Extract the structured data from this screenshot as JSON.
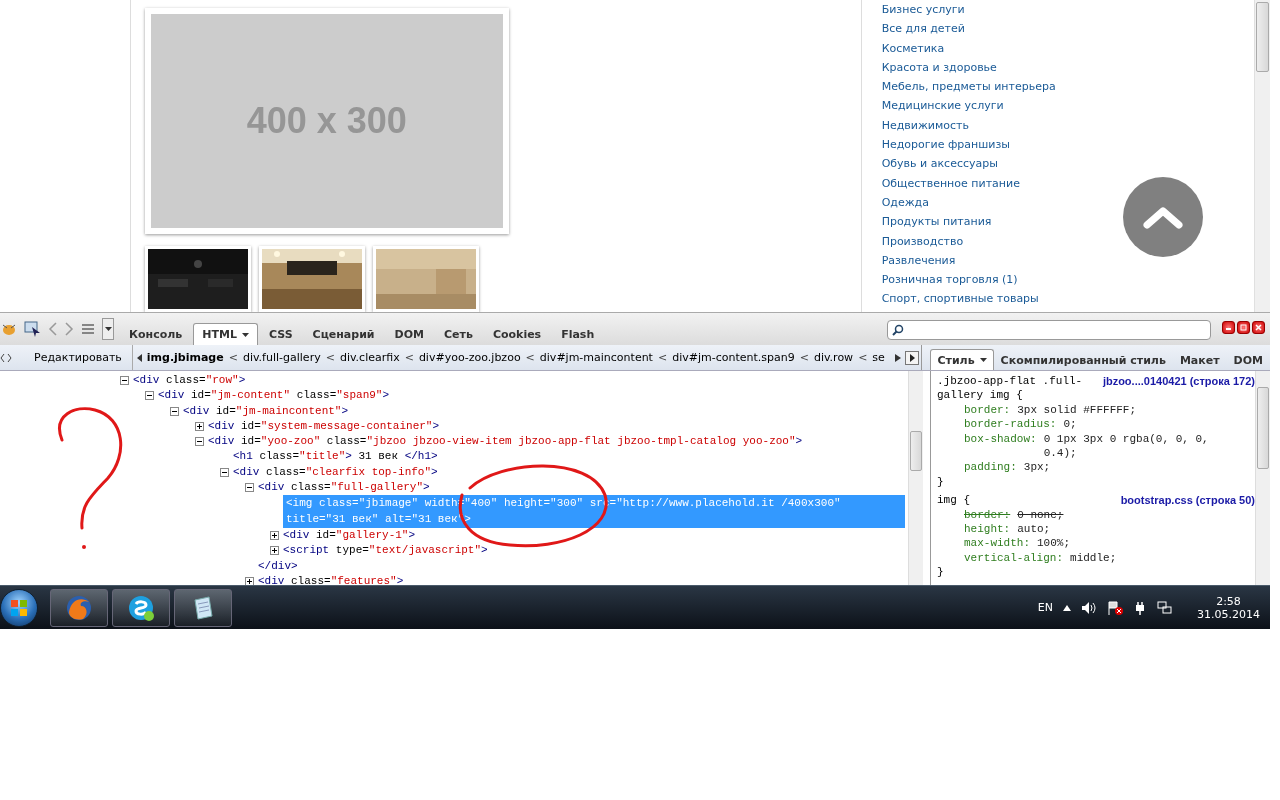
{
  "page": {
    "main_image": {
      "label": "400 x 300"
    },
    "categories": [
      "Бизнес услуги",
      "Все для детей",
      "Косметика",
      "Красота и здоровье",
      "Мебель, предметы интерьера",
      "Медицинские услуги",
      "Недвижимость",
      "Недорогие франшизы",
      "Обувь и аксессуары",
      "Общественное питание",
      "Одежда",
      "Продукты питания",
      "Производство",
      "Развлечения",
      "Розничная торговля (1)",
      "Спорт, спортивные товары"
    ]
  },
  "devtools": {
    "tabs": [
      {
        "label": "Консоль",
        "selected": false,
        "has_menu": false
      },
      {
        "label": "HTML",
        "selected": true,
        "has_menu": true
      },
      {
        "label": "CSS",
        "selected": false,
        "has_menu": false
      },
      {
        "label": "Сценарий",
        "selected": false,
        "has_menu": false
      },
      {
        "label": "DOM",
        "selected": false,
        "has_menu": false
      },
      {
        "label": "Сеть",
        "selected": false,
        "has_menu": false
      },
      {
        "label": "Cookies",
        "selected": false,
        "has_menu": false
      },
      {
        "label": "Flash",
        "selected": false,
        "has_menu": false
      }
    ],
    "edit_button": "Редактировать",
    "breadcrumb_separator": "<",
    "breadcrumbs": [
      {
        "label": "img.jbimage",
        "selected": true
      },
      {
        "label": "div.full-gallery",
        "selected": false
      },
      {
        "label": "div.clearfix",
        "selected": false
      },
      {
        "label": "div#yoo-zoo.jbzoo",
        "selected": false
      },
      {
        "label": "div#jm-maincontent",
        "selected": false
      },
      {
        "label": "div#jm-content.span9",
        "selected": false
      },
      {
        "label": "div.row",
        "selected": false
      },
      {
        "label": "se",
        "selected": false
      }
    ],
    "side_tabs": [
      {
        "label": "Стиль",
        "selected": true,
        "has_menu": true
      },
      {
        "label": "Скомпилированный стиль",
        "selected": false,
        "has_menu": false
      },
      {
        "label": "Макет",
        "selected": false,
        "has_menu": false
      },
      {
        "label": "DOM",
        "selected": false,
        "has_menu": false
      }
    ],
    "html_tree": [
      {
        "open": "<div",
        "attrs": [
          {
            "name": "class=",
            "value": "\"row\""
          }
        ],
        "close": ">",
        "expanded": true,
        "selected": false,
        "children": [
          {
            "open": "<div",
            "attrs": [
              {
                "name": "id=",
                "value": "\"jm-content\""
              },
              {
                "name": "class=",
                "value": "\"span9\""
              }
            ],
            "close": ">",
            "expanded": true,
            "selected": false,
            "children": [
              {
                "open": "<div",
                "attrs": [
                  {
                    "name": "id=",
                    "value": "\"jm-maincontent\""
                  }
                ],
                "close": ">",
                "expanded": true,
                "selected": false,
                "children": [
                  {
                    "open": "<div",
                    "attrs": [
                      {
                        "name": "id=",
                        "value": "\"system-message-container\""
                      }
                    ],
                    "close": ">",
                    "expanded": false,
                    "selected": false
                  },
                  {
                    "open": "<div",
                    "attrs": [
                      {
                        "name": "id=",
                        "value": "\"yoo-zoo\""
                      },
                      {
                        "name": "class=",
                        "value": "\"jbzoo jbzoo-view-item jbzoo-app-flat jbzoo-tmpl-catalog yoo-zoo\""
                      }
                    ],
                    "close": ">",
                    "expanded": true,
                    "selected": false,
                    "children": [
                      {
                        "open": "<h1",
                        "attrs": [
                          {
                            "name": "class=",
                            "value": "\"title\""
                          }
                        ],
                        "close": ">",
                        "text": " 31 век ",
                        "end": "</h1>",
                        "selected": false
                      },
                      {
                        "open": "<div",
                        "attrs": [
                          {
                            "name": "class=",
                            "value": "\"clearfix top-info\""
                          }
                        ],
                        "close": ">",
                        "expanded": true,
                        "selected": false,
                        "children": [
                          {
                            "open": "<div",
                            "attrs": [
                              {
                                "name": "class=",
                                "value": "\"full-gallery\""
                              }
                            ],
                            "close": ">",
                            "expanded": true,
                            "selected": false,
                            "closing": "</div>",
                            "children": [
                              {
                                "open": "<img",
                                "attrs": [
                                  {
                                    "name": "class=",
                                    "value": "\"jbimage\""
                                  },
                                  {
                                    "name": "width=",
                                    "value": "\"400\""
                                  },
                                  {
                                    "name": "height=",
                                    "value": "\"300\""
                                  },
                                  {
                                    "name": "src=",
                                    "value": "\"http://www.placehold.it /400x300\""
                                  },
                                  {
                                    "name": "title=",
                                    "value": "\"31 век\""
                                  },
                                  {
                                    "name": "alt=",
                                    "value": "\"31 век\""
                                  }
                                ],
                                "close": ">",
                                "selected": true
                              },
                              {
                                "open": "<div",
                                "attrs": [
                                  {
                                    "name": "id=",
                                    "value": "\"gallery-1\""
                                  }
                                ],
                                "close": ">",
                                "expanded": false,
                                "selected": false
                              },
                              {
                                "open": "<script",
                                "attrs": [
                                  {
                                    "name": "type=",
                                    "value": "\"text/javascript\""
                                  }
                                ],
                                "close": ">",
                                "expanded": false,
                                "selected": false
                              }
                            ]
                          },
                          {
                            "open": "<div",
                            "attrs": [
                              {
                                "name": "class=",
                                "value": "\"features\""
                              }
                            ],
                            "close": ">",
                            "expanded": false,
                            "selected": false
                          }
                        ]
                      }
                    ]
                  }
                ]
              }
            ]
          }
        ]
      }
    ],
    "css_rules": [
      {
        "selector": ".jbzoo-app-flat .full-gallery img {",
        "source": "jbzoo....0140421 (строка 172)",
        "declarations": [
          {
            "property": "border:",
            "value": "3px solid #FFFFFF;",
            "overridden": false
          },
          {
            "property": "border-radius:",
            "value": "0;",
            "overridden": false
          },
          {
            "property": "box-shadow:",
            "value": "0 1px 3px 0 rgba(0, 0, 0, 0.4);",
            "overridden": false
          },
          {
            "property": "padding:",
            "value": "3px;",
            "overridden": false
          }
        ],
        "end": "}"
      },
      {
        "selector": "img {",
        "source": "bootstrap.css (строка 50)",
        "declarations": [
          {
            "property": "border:",
            "value": "0 none;",
            "overridden": true
          },
          {
            "property": "height:",
            "value": "auto;",
            "overridden": false
          },
          {
            "property": "max-width:",
            "value": "100%;",
            "overridden": false
          },
          {
            "property": "vertical-align:",
            "value": "middle;",
            "overridden": false
          }
        ],
        "end": "}"
      }
    ]
  },
  "taskbar": {
    "apps": [
      {
        "kind": "browser"
      },
      {
        "kind": "chat"
      },
      {
        "kind": "notepad"
      }
    ],
    "language": "EN",
    "time": "2:58",
    "date": "31.05.2014"
  }
}
